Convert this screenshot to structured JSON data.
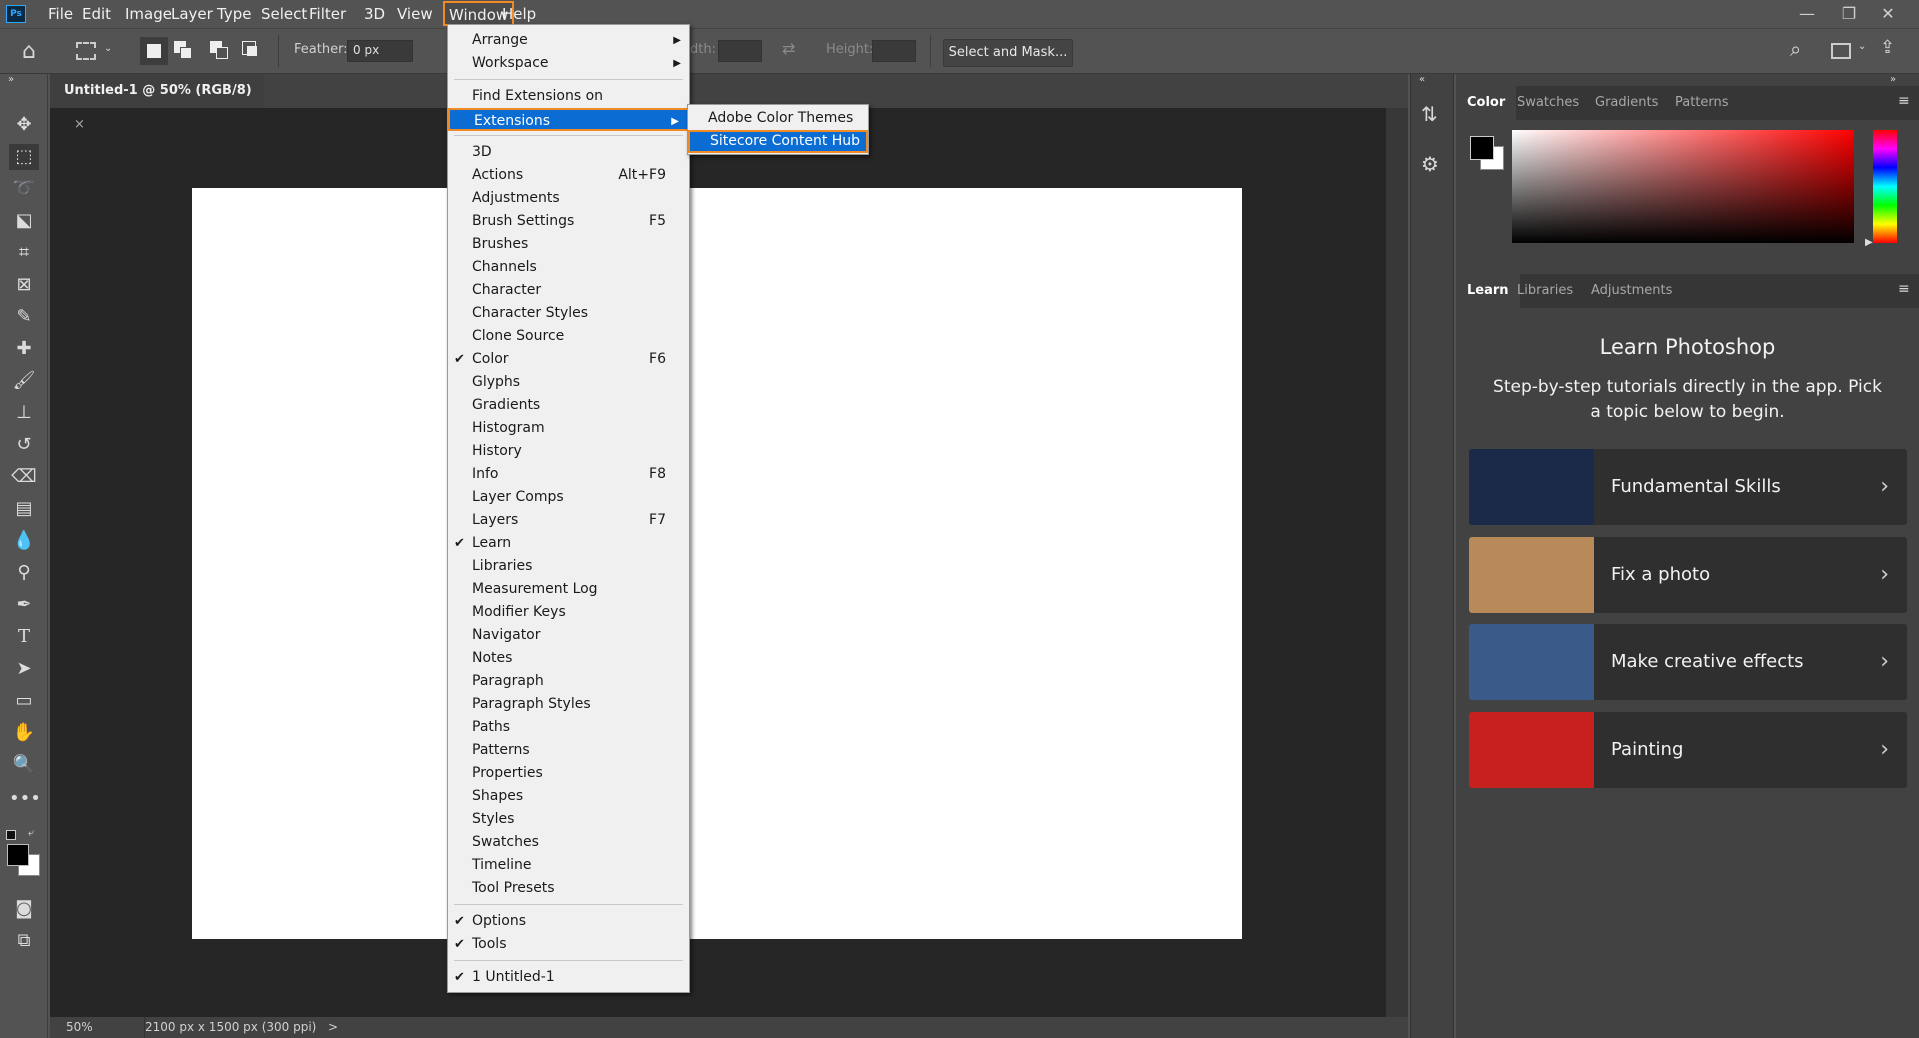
{
  "app": {
    "logo": "Ps",
    "document_tab": "Untitled-1 @ 50% (RGB/8)",
    "tab_close": "×"
  },
  "menubar": {
    "items": [
      "File",
      "Edit",
      "Image",
      "Layer",
      "Type",
      "Select",
      "Filter",
      "3D",
      "View",
      "Window",
      "Help"
    ],
    "active": "Window"
  },
  "window_controls": {
    "minimize": "—",
    "restore": "❐",
    "close": "✕"
  },
  "options": {
    "feather_label": "Feather:",
    "feather_value": "0 px",
    "width_label": "dth:",
    "height_label": "Height:",
    "select_mask": "Select and Mask..."
  },
  "window_menu": {
    "items": [
      {
        "label": "Arrange",
        "submenu": true
      },
      {
        "label": "Workspace",
        "submenu": true
      },
      {
        "separator": true
      },
      {
        "label": "Find Extensions on Exchange..."
      },
      {
        "label": "Extensions",
        "submenu": true,
        "highlighted": true
      },
      {
        "separator": true
      },
      {
        "label": "3D"
      },
      {
        "label": "Actions",
        "shortcut": "Alt+F9"
      },
      {
        "label": "Adjustments"
      },
      {
        "label": "Brush Settings",
        "shortcut": "F5"
      },
      {
        "label": "Brushes"
      },
      {
        "label": "Channels"
      },
      {
        "label": "Character"
      },
      {
        "label": "Character Styles"
      },
      {
        "label": "Clone Source"
      },
      {
        "label": "Color",
        "shortcut": "F6",
        "checked": true
      },
      {
        "label": "Glyphs"
      },
      {
        "label": "Gradients"
      },
      {
        "label": "Histogram"
      },
      {
        "label": "History"
      },
      {
        "label": "Info",
        "shortcut": "F8"
      },
      {
        "label": "Layer Comps"
      },
      {
        "label": "Layers",
        "shortcut": "F7"
      },
      {
        "label": "Learn",
        "checked": true
      },
      {
        "label": "Libraries"
      },
      {
        "label": "Measurement Log"
      },
      {
        "label": "Modifier Keys"
      },
      {
        "label": "Navigator"
      },
      {
        "label": "Notes"
      },
      {
        "label": "Paragraph"
      },
      {
        "label": "Paragraph Styles"
      },
      {
        "label": "Paths"
      },
      {
        "label": "Patterns"
      },
      {
        "label": "Properties"
      },
      {
        "label": "Shapes"
      },
      {
        "label": "Styles"
      },
      {
        "label": "Swatches"
      },
      {
        "label": "Timeline"
      },
      {
        "label": "Tool Presets"
      },
      {
        "separator": true
      },
      {
        "label": "Options",
        "checked": true
      },
      {
        "label": "Tools",
        "checked": true
      },
      {
        "separator": true
      },
      {
        "label": "1 Untitled-1",
        "checked": true
      }
    ]
  },
  "extensions_submenu": {
    "items": [
      {
        "label": "Adobe Color Themes"
      },
      {
        "label": "Sitecore Content Hub",
        "highlighted": true
      }
    ]
  },
  "color_panel": {
    "tabs": [
      "Color",
      "Swatches",
      "Gradients",
      "Patterns"
    ],
    "selected": "Color"
  },
  "learn_panel": {
    "tabs": [
      "Learn",
      "Libraries",
      "Adjustments"
    ],
    "selected": "Learn",
    "title": "Learn Photoshop",
    "subtitle": "Step-by-step tutorials directly in the app. Pick a topic below to begin.",
    "cards": [
      {
        "label": "Fundamental Skills",
        "thumb_color": "#1c2a4a"
      },
      {
        "label": "Fix a photo",
        "thumb_color": "#b88a5a"
      },
      {
        "label": "Make creative effects",
        "thumb_color": "#3a5a8a"
      },
      {
        "label": "Painting",
        "thumb_color": "#c8201e"
      }
    ]
  },
  "status": {
    "zoom": "50%",
    "doc_info": "2100 px x 1500 px (300 ppi)",
    "arrow": ">"
  }
}
